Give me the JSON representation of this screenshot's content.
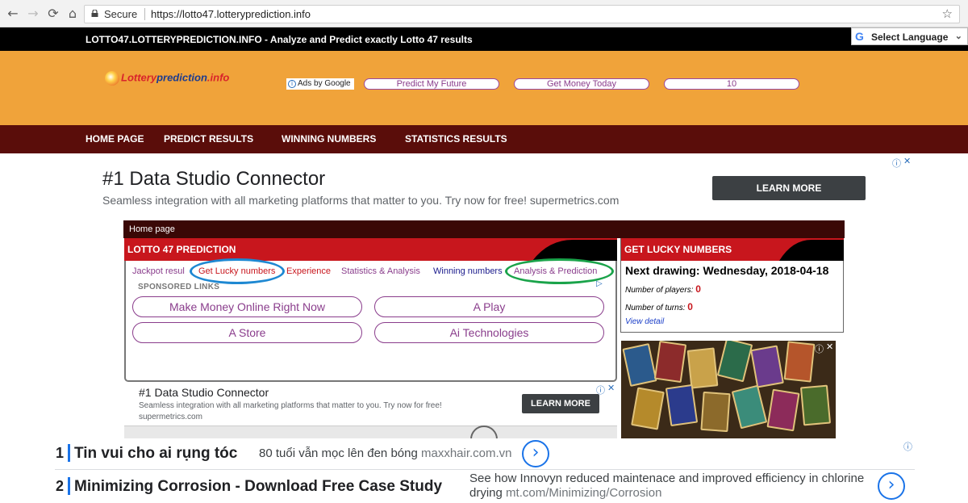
{
  "browser": {
    "secure_label": "Secure",
    "url": "https://lotto47.lotteryprediction.info",
    "back_glyph": "←",
    "forward_glyph": "→",
    "reload_glyph": "⟳",
    "home_glyph": "⌂",
    "star_glyph": "☆"
  },
  "topbar": {
    "text": "LOTTO47.LOTTERYPREDICTION.INFO - Analyze and Predict exactly Lotto 47 results",
    "language_label": "Select Language",
    "google_glyph": "G",
    "chevron_glyph": "⌄"
  },
  "header": {
    "logo_part1": "Lottery",
    "logo_part2": "prediction",
    "logo_part3": ".info",
    "ads_by": "Ads by Google",
    "pills": [
      "Predict My Future",
      "Get Money Today",
      "10"
    ]
  },
  "nav": {
    "items": [
      "HOME PAGE",
      "PREDICT RESULTS",
      "WINNING NUMBERS",
      "STATISTICS RESULTS"
    ]
  },
  "banner_ad": {
    "title": "#1 Data Studio Connector",
    "subtitle": "Seamless integration with all marketing platforms that matter to you. Try now for free! supermetrics.com",
    "cta": "LEARN MORE"
  },
  "breadcrumb": "Home page",
  "prediction": {
    "heading": "LOTTO 47 PREDICTION",
    "tabs": [
      "Jackpot resul",
      "Get Lucky numbers",
      "Experience",
      "Statistics & Analysis",
      "Winning numbers",
      "Analysis & Prediction"
    ],
    "sponsored_label": "SPONSORED LINKS",
    "links": [
      "Make Money Online Right Now",
      "A Play",
      "A Store",
      "Ai Technologies"
    ]
  },
  "lucky": {
    "heading": "GET LUCKY NUMBERS",
    "next_drawing": "Next drawing: Wednesday, 2018-04-18",
    "players_label": "Number of players:",
    "players_value": "0",
    "turns_label": "Number of turns:",
    "turns_value": "0",
    "view_detail": "View detail"
  },
  "small_ad": {
    "title": "#1 Data Studio Connector",
    "subtitle": "Seamless integration with all marketing platforms that matter to you. Try now for free! supermetrics.com",
    "cta": "LEARN MORE"
  },
  "bottom_ads": [
    {
      "num": "1",
      "title": "Tin vui cho ai rụng tóc",
      "desc": "80 tuổi vẫn mọc lên đen bóng",
      "domain": "maxxhair.com.vn"
    },
    {
      "num": "2",
      "title": "Minimizing Corrosion - Download Free Case Study",
      "desc": "See how Innovyn reduced maintenace and improved efficiency in chlorine drying",
      "domain": "mt.com/Minimizing/Corrosion"
    }
  ],
  "colors": {
    "orange": "#f0a33a",
    "dark_red": "#5a0d0a",
    "red": "#c8161d",
    "purple": "#8a3d8c",
    "blue_ring": "#1e88d2",
    "green_ring": "#1aa34a"
  }
}
